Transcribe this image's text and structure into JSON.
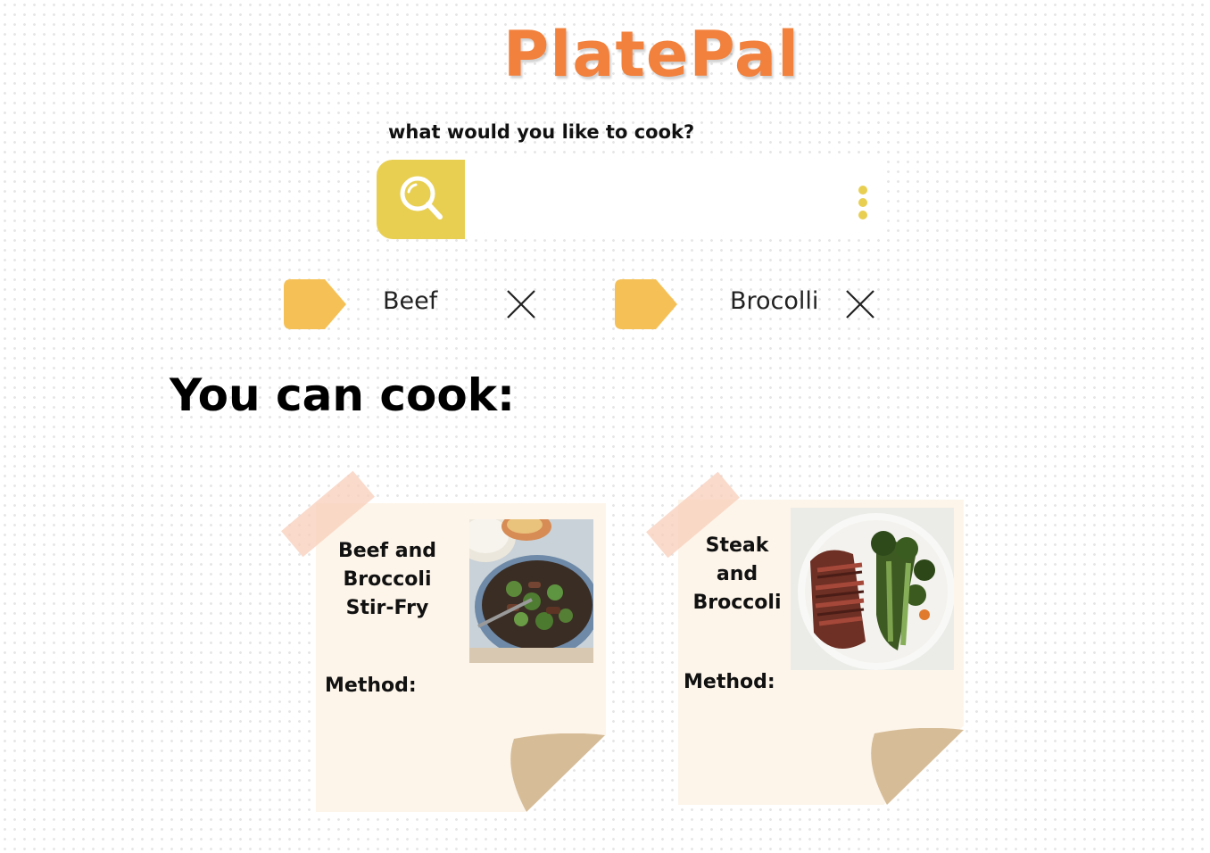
{
  "app": {
    "logo": "PlatePal",
    "prompt": "what would you like to cook?"
  },
  "search": {
    "value": "",
    "placeholder": "",
    "search_icon": "search-icon",
    "more_icon": "more-vertical-icon"
  },
  "ingredients": [
    {
      "label": "Beef",
      "icon": "tag-icon",
      "remove_icon": "close-icon"
    },
    {
      "label": "Brocolli",
      "icon": "tag-icon",
      "remove_icon": "close-icon"
    }
  ],
  "results": {
    "heading": "You can cook:",
    "recipes": [
      {
        "title": "Beef and Broccoli Stir-Fry",
        "method_label": "Method:",
        "image": "beef-broccoli-stir-fry-photo"
      },
      {
        "title": "Steak and Broccoli",
        "method_label": "Method:",
        "image": "steak-broccoli-photo"
      }
    ]
  },
  "colors": {
    "brand": "#f2813d",
    "accent": "#e8cf52",
    "tag": "#f5c157",
    "card": "#fdf5ea",
    "curl": "#d6bc97",
    "tape": "#f8cdb9"
  }
}
